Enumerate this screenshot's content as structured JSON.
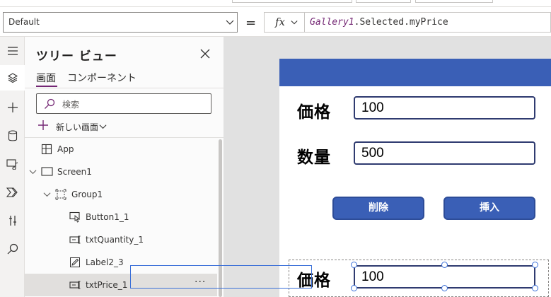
{
  "formula_bar": {
    "property": "Default",
    "equals": "=",
    "fx_label": "fx",
    "formula_control": "Gallery1",
    "formula_rest": ".Selected.myPrice"
  },
  "tree_view": {
    "title": "ツリー ビュー",
    "tabs": [
      "画面",
      "コンポーネント"
    ],
    "search_placeholder": "検索",
    "new_screen_label": "新しい画面",
    "items": [
      {
        "label": "App",
        "icon": "app-icon"
      },
      {
        "label": "Screen1",
        "icon": "screen-icon"
      },
      {
        "label": "Group1",
        "icon": "group-icon"
      },
      {
        "label": "Button1_1",
        "icon": "button-control-icon"
      },
      {
        "label": "txtQuantity_1",
        "icon": "text-input-icon"
      },
      {
        "label": "Label2_3",
        "icon": "label-icon"
      },
      {
        "label": "txtPrice_1",
        "icon": "text-input-icon"
      }
    ],
    "more_label": "···"
  },
  "canvas": {
    "price_label": "価格",
    "price_value": "100",
    "quantity_label": "数量",
    "quantity_value": "500",
    "delete_button": "削除",
    "insert_button": "挿入",
    "selected_label": "価格",
    "selected_value": "100"
  },
  "colors": {
    "header_blue": "#3a5fb6",
    "accent_purple": "#742774",
    "selection_blue": "#3a6fd8"
  }
}
